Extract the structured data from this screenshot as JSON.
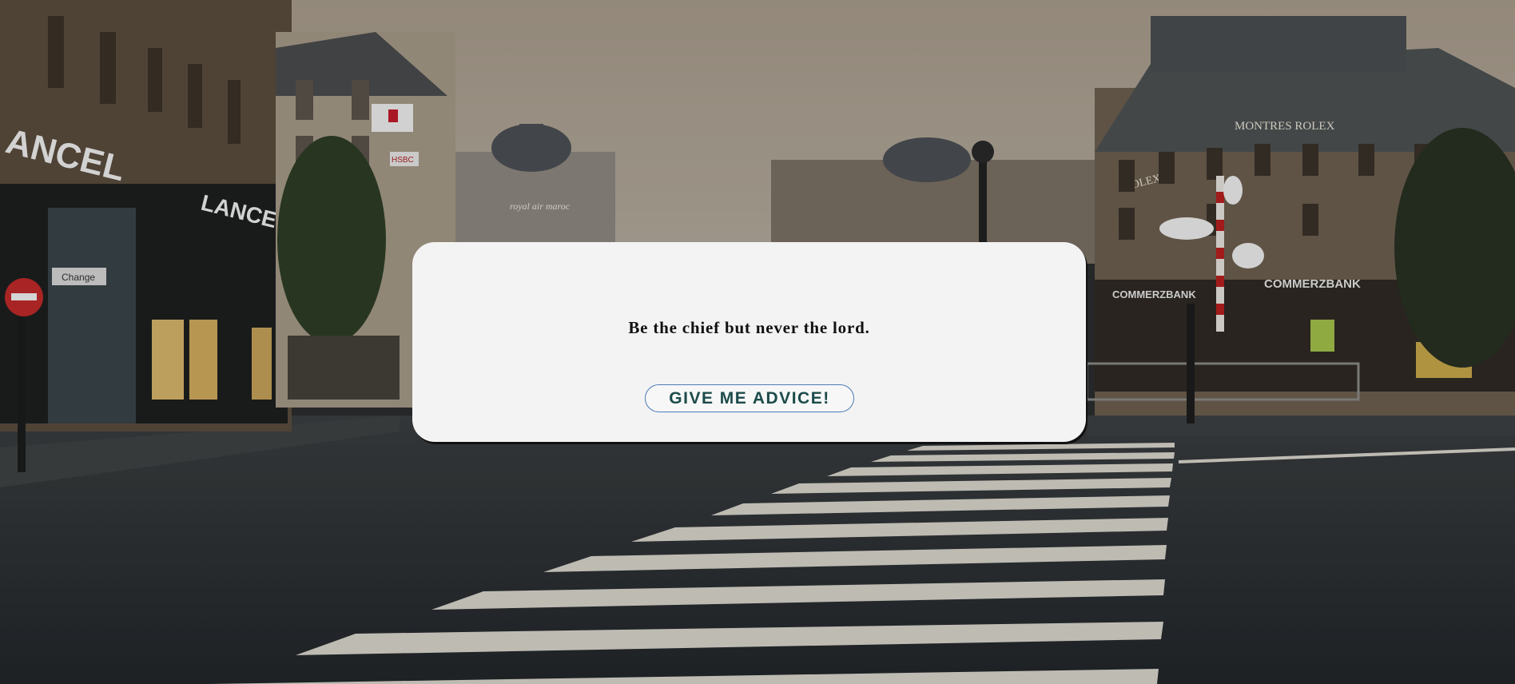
{
  "advice": {
    "quote": "Be the chief but never the lord."
  },
  "actions": {
    "advice_button_label": "GIVE ME ADVICE!"
  },
  "background_signage": {
    "lancel_left": "ANCEL",
    "lancel_right": "LANCEL",
    "change_sign": "Change",
    "royal_air_maroc": "royal air maroc",
    "montres_rolex": "MONTRES ROLEX",
    "rolex_small": "ROLEX",
    "commerzbank_left": "COMMERZBANK",
    "commerzbank_right": "COMMERZBANK",
    "hsbc": "HSBC"
  },
  "colors": {
    "sky": "#aaa091",
    "card_background": "#f3f3f3",
    "button_border": "#4d7bb8",
    "button_text": "#1c4b4a",
    "road": "#2c3033"
  }
}
